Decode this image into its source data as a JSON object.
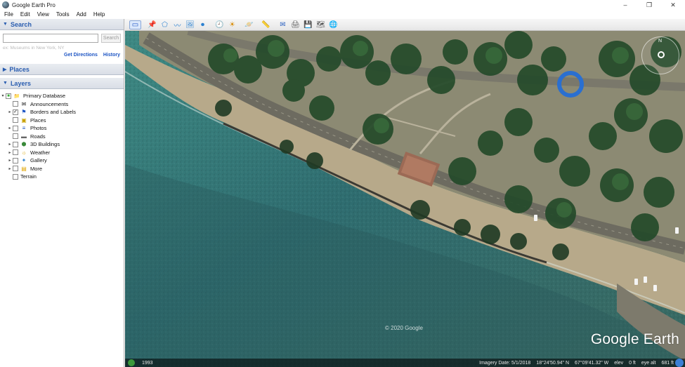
{
  "window": {
    "title": "Google Earth Pro",
    "minimize": "–",
    "maximize": "❐",
    "close": "✕"
  },
  "menu": [
    "File",
    "Edit",
    "View",
    "Tools",
    "Add",
    "Help"
  ],
  "search": {
    "header": "Search",
    "placeholder": "",
    "button": "Search",
    "hint": "ex: Museums in New York, NY",
    "get_directions": "Get Directions",
    "history": "History"
  },
  "places": {
    "header": "Places"
  },
  "layers": {
    "header": "Layers",
    "items": [
      {
        "label": "Primary Database",
        "checked": "■",
        "expander": "▾",
        "icon": "📁"
      },
      {
        "label": "Announcements",
        "checked": "",
        "expander": "",
        "icon": "✉"
      },
      {
        "label": "Borders and Labels",
        "checked": "✓",
        "expander": "▸",
        "icon": "⚑"
      },
      {
        "label": "Places",
        "checked": "",
        "expander": "",
        "icon": "▣"
      },
      {
        "label": "Photos",
        "checked": "",
        "expander": "▸",
        "icon": "≡"
      },
      {
        "label": "Roads",
        "checked": "",
        "expander": "",
        "icon": "▬"
      },
      {
        "label": "3D Buildings",
        "checked": "",
        "expander": "▸",
        "icon": "⬢"
      },
      {
        "label": "Weather",
        "checked": "",
        "expander": "▸",
        "icon": "☼"
      },
      {
        "label": "Gallery",
        "checked": "",
        "expander": "▸",
        "icon": "✦"
      },
      {
        "label": "More",
        "checked": "",
        "expander": "▸",
        "icon": "▤"
      },
      {
        "label": "Terrain",
        "checked": "",
        "expander": "",
        "icon": ""
      }
    ]
  },
  "toolbar": {
    "icons": [
      "sidebar-toggle-icon",
      "placemark-icon",
      "polygon-icon",
      "path-icon",
      "image-overlay-icon",
      "record-tour-icon",
      "historical-imagery-icon",
      "sunlight-icon",
      "planets-icon",
      "ruler-icon",
      "email-icon",
      "print-icon",
      "save-image-icon",
      "maps-icon",
      "earth-icon"
    ],
    "glyphs": [
      "▭",
      "📌",
      "⬠",
      "〰",
      "🖼",
      "⏺",
      "🕘",
      "☀",
      "🪐",
      "📏",
      "✉",
      "🖨",
      "💾",
      "🗺",
      "🌐"
    ]
  },
  "map": {
    "watermark": "© 2020 Google",
    "brand": "Google Earth",
    "status": {
      "year": "1993",
      "imagery_date": "Imagery Date: 5/1/2018",
      "lat": "18°24'50.94\" N",
      "lon": "67°09'41.32\" W",
      "elev": "elev",
      "elev_value": "0 ft",
      "eye_alt": "eye alt",
      "eye_alt_value": "681 ft"
    },
    "compass_n": "N"
  }
}
